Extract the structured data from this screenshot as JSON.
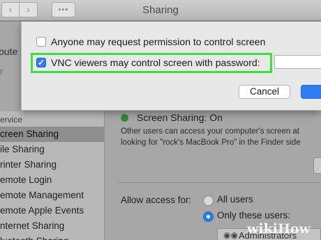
{
  "window": {
    "title": "Sharing",
    "nav_back_icon": "‹",
    "nav_forward_icon": "›",
    "grid_icon": "▪▪▪"
  },
  "computer": {
    "name_fragment": "pute",
    "sub_fragment": "r"
  },
  "sidebar": {
    "header": "ervice",
    "items": [
      {
        "label": "creen Sharing",
        "selected": true
      },
      {
        "label": "ile Sharing"
      },
      {
        "label": "rinter Sharing"
      },
      {
        "label": "emote Login"
      },
      {
        "label": "emote Management"
      },
      {
        "label": "emote Apple Events"
      },
      {
        "label": "nternet Sharing"
      },
      {
        "label": "luetooth Sharing"
      }
    ]
  },
  "main": {
    "status": "Screen Sharing: On",
    "status_color": "#2f8e2f",
    "desc_line1": "Other users can access your computer's screen at",
    "desc_line2": "looking for \"rock's MacBook Pro\" in the Finder side",
    "allow_label": "Allow access for:",
    "radio_all": "All users",
    "radio_only": "Only these users:",
    "users_entry": "Administrators"
  },
  "sheet": {
    "checkbox1_label": "Anyone may request permission to control screen",
    "checkbox2_label": "VNC viewers may control screen with password:",
    "checkbox2_mark": "✓",
    "cancel_label": "Cancel",
    "highlight_color": "#36e336",
    "accent": "#2c7ff3"
  },
  "watermark": {
    "prefix": "wiki",
    "suffix": "How"
  }
}
